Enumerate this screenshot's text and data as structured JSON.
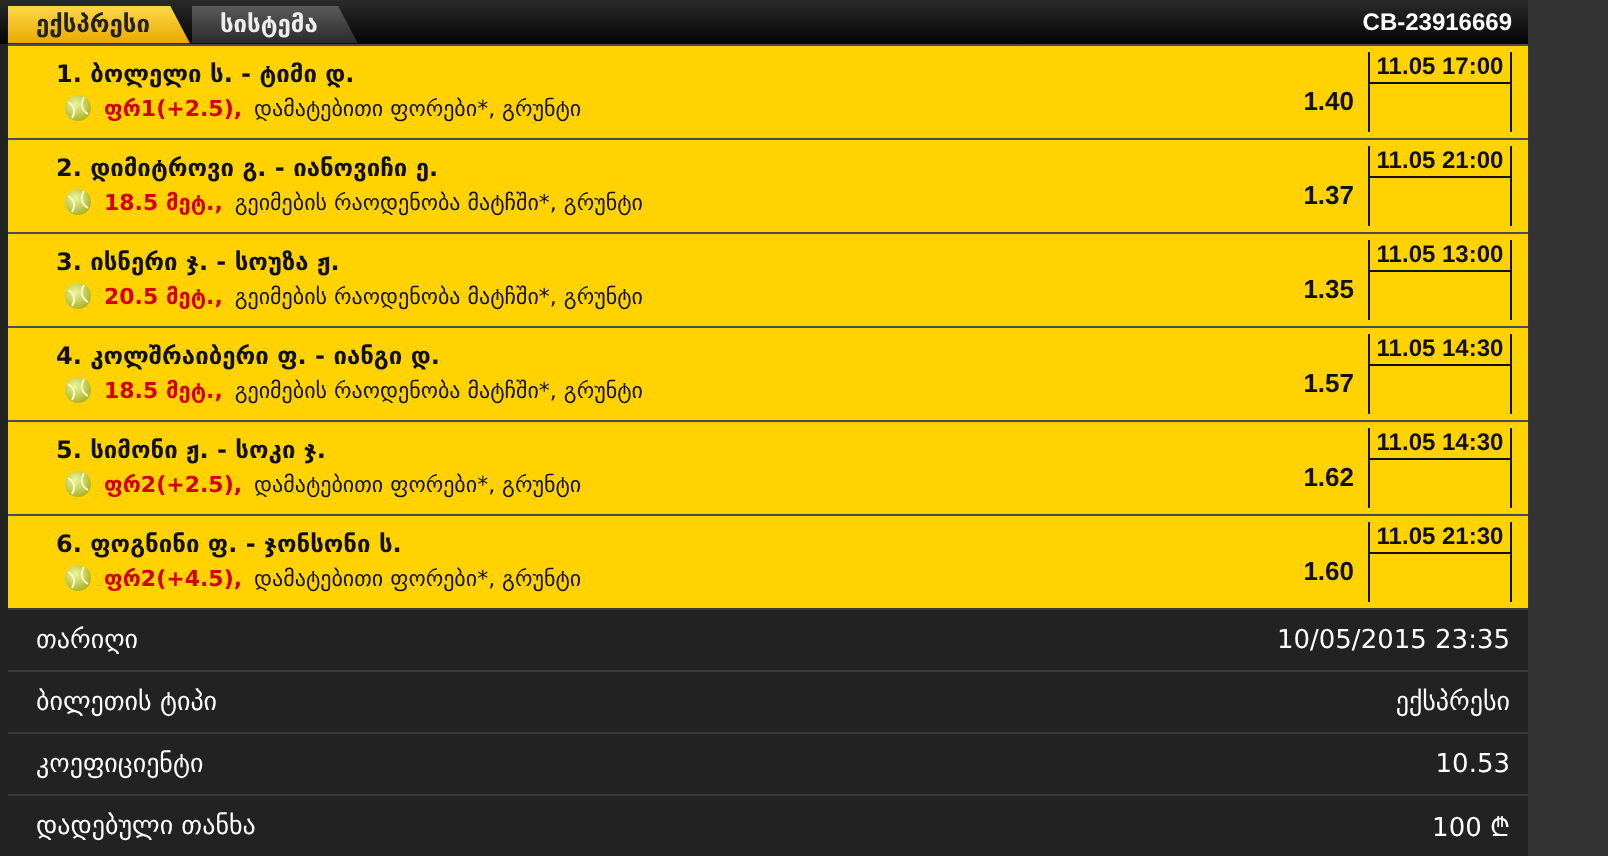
{
  "tabs": [
    {
      "label": "ექსპრესი",
      "selected": true
    },
    {
      "label": "სისტემა",
      "selected": false
    }
  ],
  "ticket_id": "CB-23916669",
  "events": [
    {
      "title": "1. ბოლელი ს. - ტიმი დ.",
      "bet": "ფრ1(+2.5),",
      "market": "დამატებითი ფორები*, გრუნტი",
      "odds": "1.40",
      "time": "11.05 17:00"
    },
    {
      "title": "2. დიმიტროვი გ. - იანოვიჩი ე.",
      "bet": "18.5 მეტ.,",
      "market": "გეიმების რაოდენობა მატჩში*, გრუნტი",
      "odds": "1.37",
      "time": "11.05 21:00"
    },
    {
      "title": "3. ისნერი ჯ. - სოუზა ჟ.",
      "bet": "20.5 მეტ.,",
      "market": "გეიმების რაოდენობა მატჩში*, გრუნტი",
      "odds": "1.35",
      "time": "11.05 13:00"
    },
    {
      "title": "4. კოლშრაიბერი ფ. - იანგი დ.",
      "bet": "18.5 მეტ.,",
      "market": "გეიმების რაოდენობა მატჩში*, გრუნტი",
      "odds": "1.57",
      "time": "11.05 14:30"
    },
    {
      "title": "5. სიმონი ჟ. - სოკი ჯ.",
      "bet": "ფრ2(+2.5),",
      "market": "დამატებითი ფორები*, გრუნტი",
      "odds": "1.62",
      "time": "11.05 14:30"
    },
    {
      "title": "6. ფოგნინი ფ. - ჯონსონი ს.",
      "bet": "ფრ2(+4.5),",
      "market": "დამატებითი ფორები*, გრუნტი",
      "odds": "1.60",
      "time": "11.05 21:30"
    }
  ],
  "summary": [
    {
      "label": "თარიღი",
      "value": "10/05/2015 23:35"
    },
    {
      "label": "ბილეთის ტიპი",
      "value": "ექსპრესი"
    },
    {
      "label": "კოეფიციენტი",
      "value": "10.53"
    },
    {
      "label": "დადებული თანხა",
      "value": "100 ₾"
    }
  ]
}
